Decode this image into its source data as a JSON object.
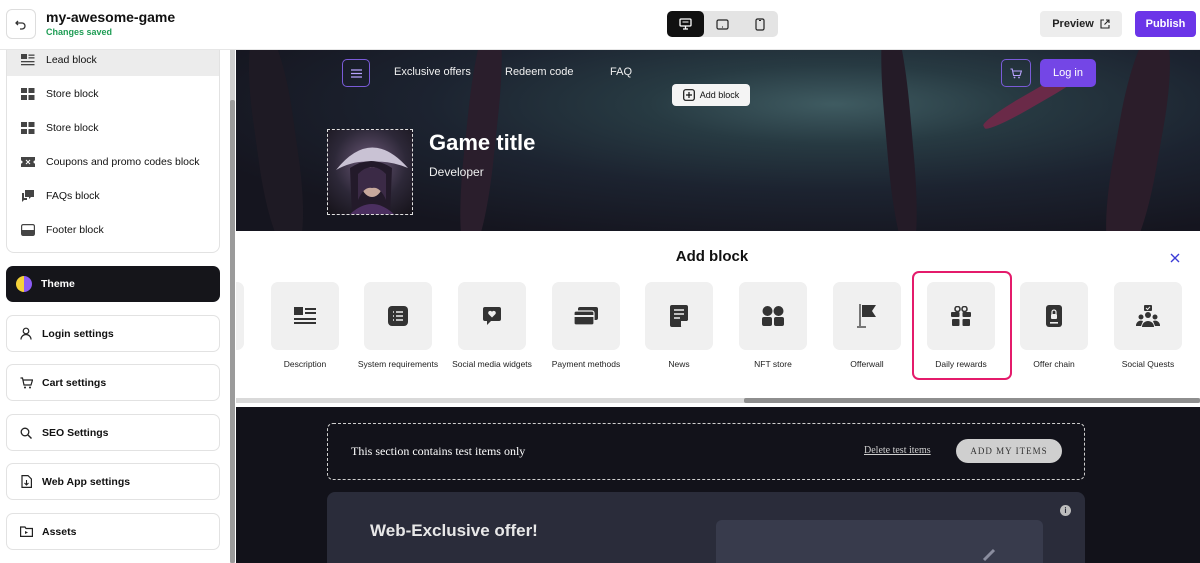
{
  "header": {
    "project_name": "my-awesome-game",
    "save_status": "Changes saved",
    "devices": [
      "desktop-icon",
      "tablet-icon",
      "mobile-icon"
    ],
    "active_device": "desktop",
    "preview_label": "Preview",
    "publish_label": "Publish",
    "publish_color": "#6b35e8"
  },
  "sidebar": {
    "blocks": [
      {
        "label": "Lead block",
        "icon": "lead-block-icon",
        "selected": true
      },
      {
        "label": "Store block",
        "icon": "store-block-icon"
      },
      {
        "label": "Store block",
        "icon": "store-block-icon"
      },
      {
        "label": "Coupons and promo codes block",
        "icon": "coupon-icon"
      },
      {
        "label": "FAQs block",
        "icon": "faq-icon"
      },
      {
        "label": "Footer block",
        "icon": "footer-icon"
      }
    ],
    "theme_label": "Theme",
    "settings": [
      {
        "label": "Login settings",
        "icon": "user-icon"
      },
      {
        "label": "Cart settings",
        "icon": "cart-icon"
      },
      {
        "label": "SEO Settings",
        "icon": "search-icon"
      },
      {
        "label": "Web App settings",
        "icon": "web-app-icon"
      },
      {
        "label": "Assets",
        "icon": "assets-icon"
      }
    ]
  },
  "site": {
    "nav": [
      "Exclusive offers",
      "Redeem code",
      "FAQ"
    ],
    "add_block_label": "Add block",
    "login_label": "Log in",
    "game_title": "Game title",
    "developer": "Developer",
    "accent": "#7446e6"
  },
  "add_block_panel": {
    "title": "Add block",
    "tiles": [
      {
        "label": "Description",
        "icon": "description-icon"
      },
      {
        "label": "System requirements",
        "icon": "list-icon"
      },
      {
        "label": "Social media widgets",
        "icon": "chat-heart-icon"
      },
      {
        "label": "Payment methods",
        "icon": "credit-card-icon"
      },
      {
        "label": "News",
        "icon": "news-icon"
      },
      {
        "label": "NFT store",
        "icon": "nft-store-icon"
      },
      {
        "label": "Offerwall",
        "icon": "flag-icon"
      },
      {
        "label": "Daily rewards",
        "icon": "gift-icon",
        "highlighted": true
      },
      {
        "label": "Offer chain",
        "icon": "lock-icon"
      },
      {
        "label": "Social Quests",
        "icon": "group-icon"
      }
    ],
    "highlight_color": "#e41b6b"
  },
  "test_section": {
    "text": "This section contains test items only",
    "delete_label": "Delete test items",
    "add_label": "ADD MY ITEMS"
  },
  "offer": {
    "title": "Web-Exclusive offer!"
  }
}
